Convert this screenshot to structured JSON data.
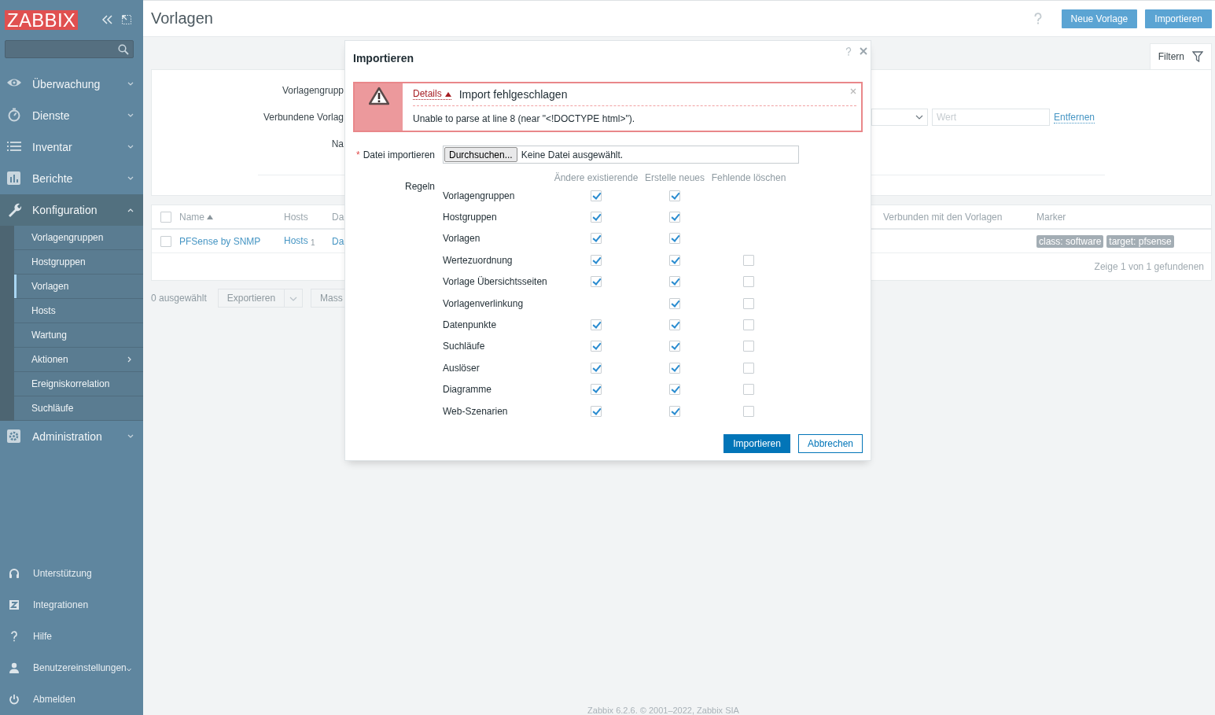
{
  "sidebar": {
    "logo": "ZABBIX",
    "menu": [
      {
        "label": "Überwachung",
        "expanded": false
      },
      {
        "label": "Dienste",
        "expanded": false
      },
      {
        "label": "Inventar",
        "expanded": false
      },
      {
        "label": "Berichte",
        "expanded": false
      },
      {
        "label": "Konfiguration",
        "expanded": true,
        "children": [
          {
            "label": "Vorlagengruppen",
            "selected": false,
            "submenu": false
          },
          {
            "label": "Hostgruppen",
            "selected": false,
            "submenu": false
          },
          {
            "label": "Vorlagen",
            "selected": true,
            "submenu": false
          },
          {
            "label": "Hosts",
            "selected": false,
            "submenu": false
          },
          {
            "label": "Wartung",
            "selected": false,
            "submenu": false
          },
          {
            "label": "Aktionen",
            "selected": false,
            "submenu": true
          },
          {
            "label": "Ereigniskorrelation",
            "selected": false,
            "submenu": false
          },
          {
            "label": "Suchläufe",
            "selected": false,
            "submenu": false
          }
        ]
      },
      {
        "label": "Administration",
        "expanded": false
      }
    ],
    "bottom_menu": [
      {
        "label": "Unterstützung",
        "submenu": false
      },
      {
        "label": "Integrationen",
        "submenu": false
      },
      {
        "label": "Hilfe",
        "submenu": false
      },
      {
        "label": "Benutzereinstellungen",
        "submenu": true
      },
      {
        "label": "Abmelden",
        "submenu": false
      }
    ]
  },
  "header": {
    "title": "Vorlagen",
    "buttons": [
      "Neue Vorlage",
      "Importieren"
    ]
  },
  "filter": {
    "tab": "Filtern",
    "labels": [
      "Vorlagengrupp",
      "Verbundene Vorlag",
      "Na"
    ],
    "tag_value": {
      "placeholder": "Wert"
    },
    "remove_link": "Entfernen"
  },
  "table": {
    "all_selected": false,
    "columns": [
      {
        "label": "Name",
        "sorted": true
      },
      {
        "label": "Hosts",
        "sorted": false
      },
      {
        "label": "Da"
      },
      {
        "label": "Verbunden mit den Vorlagen",
        "sorted": false
      },
      {
        "label": "Marker",
        "sorted": false
      }
    ],
    "rows": [
      {
        "selected": false,
        "name": "PFSense by SNMP",
        "hosts": "Hosts",
        "hosts_count": "1",
        "column_3": "Da",
        "tags": [
          "class: software",
          "target: pfsense"
        ]
      }
    ],
    "footer": "Zeige 1 von 1 gefundenen"
  },
  "actions": {
    "selected_count": "0 ausgewählt",
    "buttons": [
      {
        "label": "Exportieren",
        "dropdown": true,
        "disabled": true
      },
      {
        "label": "Mass",
        "dropdown": false,
        "disabled": true
      }
    ]
  },
  "dialog": {
    "title": "Importieren",
    "error": {
      "details": "Details",
      "expanded": true,
      "title": "Import fehlgeschlagen",
      "messages": [
        "Unable to parse at line 8 (near \"<!DOCTYPE html>\")."
      ]
    },
    "file": {
      "required_mark": "*",
      "label": "Datei importieren",
      "button": "Durchsuchen...",
      "value": "Keine Datei ausgewählt."
    },
    "rules": {
      "label": "Regeln",
      "columns": [
        "Ändere existierende",
        "Erstelle neues",
        "Fehlende löschen"
      ],
      "rows": [
        {
          "label": "Vorlagengruppen",
          "update": {
            "checked": true
          },
          "create": {
            "checked": true
          }
        },
        {
          "label": "Hostgruppen",
          "update": {
            "checked": true
          },
          "create": {
            "checked": true
          }
        },
        {
          "label": "Vorlagen",
          "update": {
            "checked": true
          },
          "create": {
            "checked": true
          }
        },
        {
          "label": "Wertezuordnung",
          "update": {
            "checked": true
          },
          "create": {
            "checked": true
          },
          "delete": {
            "checked": false
          }
        },
        {
          "label": "Vorlage Übersichtsseiten",
          "update": {
            "checked": true
          },
          "create": {
            "checked": true
          },
          "delete": {
            "checked": false
          }
        },
        {
          "label": "Vorlagenverlinkung",
          "create": {
            "checked": true
          },
          "delete": {
            "checked": false
          }
        },
        {
          "label": "Datenpunkte",
          "update": {
            "checked": true
          },
          "create": {
            "checked": true
          },
          "delete": {
            "checked": false
          }
        },
        {
          "label": "Suchläufe",
          "update": {
            "checked": true
          },
          "create": {
            "checked": true
          },
          "delete": {
            "checked": false
          }
        },
        {
          "label": "Auslöser",
          "update": {
            "checked": true
          },
          "create": {
            "checked": true
          },
          "delete": {
            "checked": false
          }
        },
        {
          "label": "Diagramme",
          "update": {
            "checked": true
          },
          "create": {
            "checked": true
          },
          "delete": {
            "checked": false
          }
        },
        {
          "label": "Web-Szenarien",
          "update": {
            "checked": true
          },
          "create": {
            "checked": true
          },
          "delete": {
            "checked": false
          }
        }
      ]
    },
    "buttons": [
      {
        "label": "Importieren",
        "primary": true
      },
      {
        "label": "Abbrechen",
        "primary": false
      }
    ]
  },
  "footer": "Zabbix 6.2.6. © 2001–2022, Zabbix SIA"
}
